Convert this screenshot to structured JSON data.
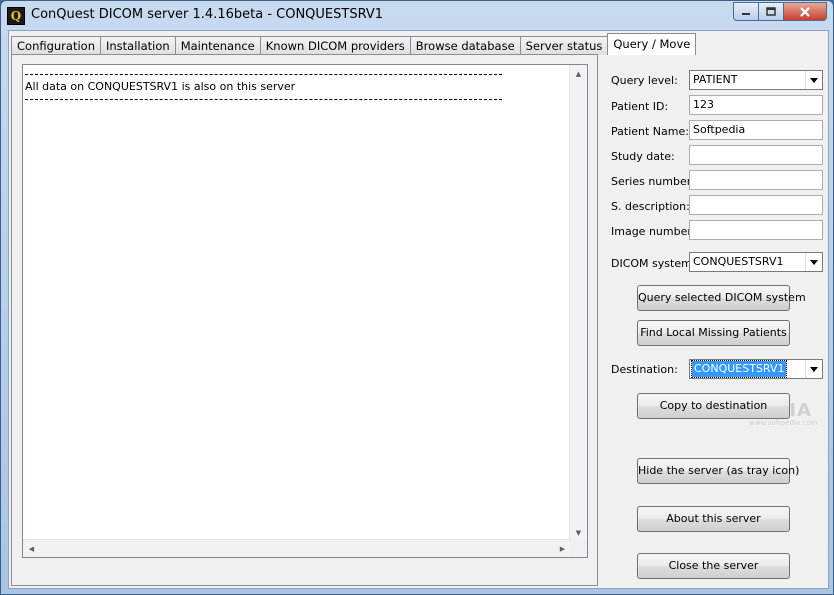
{
  "window": {
    "title": "ConQuest DICOM server 1.4.16beta - CONQUESTSRV1",
    "icon_letter": "Q",
    "icon": "app-q-icon",
    "controls": [
      "minimize-icon",
      "maximize-icon",
      "close-icon"
    ]
  },
  "tabs": [
    {
      "label": "Configuration"
    },
    {
      "label": "Installation"
    },
    {
      "label": "Maintenance"
    },
    {
      "label": "Known DICOM providers"
    },
    {
      "label": "Browse database"
    },
    {
      "label": "Server status"
    },
    {
      "label": "Query / Move",
      "active": true
    }
  ],
  "log": {
    "line1": "All data on CONQUESTSRV1 is also on this server"
  },
  "form": {
    "query_level_label": "Query level:",
    "query_level_value": "PATIENT",
    "patient_id_label": "Patient ID:",
    "patient_id_value": "123",
    "patient_name_label": "Patient Name:",
    "patient_name_value": "Softpedia",
    "study_date_label": "Study date:",
    "study_date_value": "",
    "series_number_label": "Series number:",
    "series_number_value": "",
    "s_description_label": "S. description:",
    "s_description_value": "",
    "image_number_label": "Image number:",
    "image_number_value": "",
    "dicom_system_label": "DICOM system:",
    "dicom_system_value": "CONQUESTSRV1",
    "destination_label": "Destination:",
    "destination_value": "CONQUESTSRV1"
  },
  "buttons": {
    "query_selected": "Query selected DICOM system",
    "find_missing": "Find Local Missing Patients",
    "copy_to_destination": "Copy to destination",
    "hide_server": "Hide the server (as tray icon)",
    "about": "About this server",
    "close_server": "Close the server"
  },
  "watermark": {
    "brand": "SOFTPEDIA",
    "url": "www.softpedia.com"
  },
  "colors": {
    "title_bar": "#b9d1ea",
    "close_button": "#c7412b",
    "selection": "#3399ff"
  }
}
